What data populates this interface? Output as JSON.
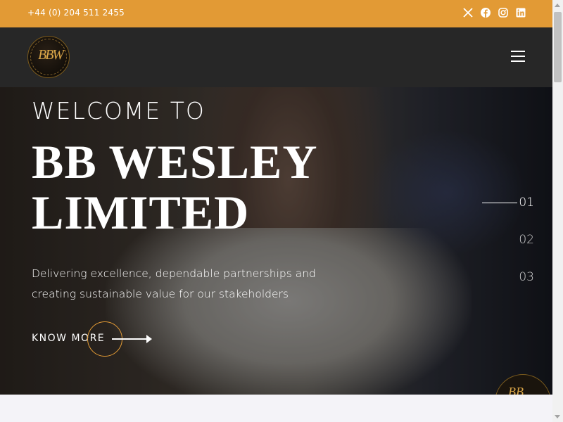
{
  "topbar": {
    "phone": "+44 (0) 204 511 2455",
    "socials": [
      "x-icon",
      "facebook-icon",
      "instagram-icon",
      "linkedin-icon"
    ],
    "background": "#e29a35"
  },
  "header": {
    "logo_text": "BBW",
    "logo_ring_text": "BB WESLEY LIMITED",
    "menu_icon": "hamburger-menu-icon",
    "background": "#272727"
  },
  "hero": {
    "welcome": "WELCOME TO",
    "title_line1": "BB WESLEY",
    "title_line2": "LIMITED",
    "tagline": "Delivering excellence, dependable partnerships and creating sustainable value for our stakeholders",
    "cta": "KNOW MORE",
    "slides": [
      "01",
      "02",
      "03"
    ],
    "active_slide": "01",
    "accent": "#e29a35"
  },
  "badge": {
    "mark": "BB"
  }
}
